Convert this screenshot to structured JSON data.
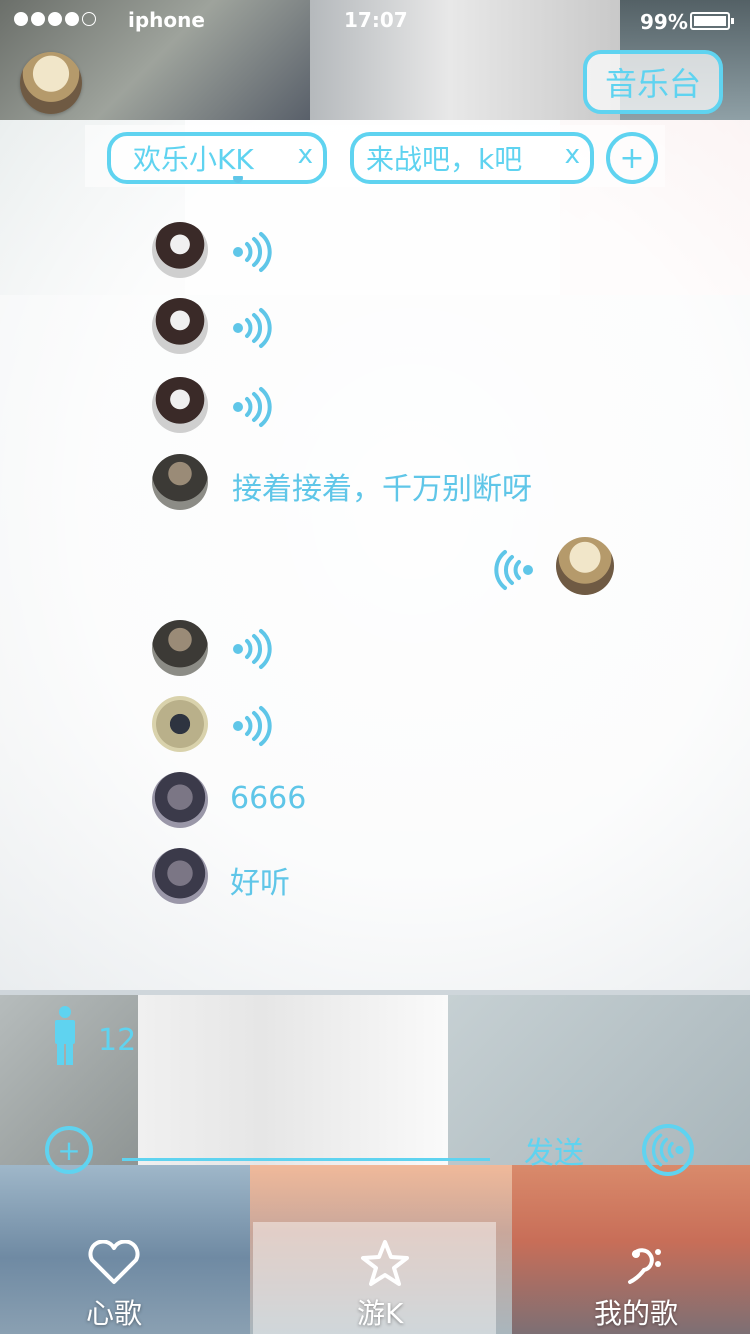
{
  "status_bar": {
    "carrier": "iphone",
    "time": "17:07",
    "battery": "99%"
  },
  "header": {
    "music_station_button": "音乐台"
  },
  "room_tabs": [
    {
      "label": "欢乐小KK",
      "close": "x"
    },
    {
      "label": "来战吧，k吧",
      "close": "x"
    }
  ],
  "add_tab_label": "+",
  "messages": [
    {
      "side": "left",
      "kind": "voice"
    },
    {
      "side": "left",
      "kind": "voice"
    },
    {
      "side": "left",
      "kind": "voice"
    },
    {
      "side": "left",
      "kind": "voice"
    },
    {
      "side": "left",
      "kind": "text",
      "text": "接着接着，千万别断呀"
    },
    {
      "side": "right",
      "kind": "voice"
    },
    {
      "side": "left",
      "kind": "voice"
    },
    {
      "side": "left",
      "kind": "voice"
    },
    {
      "side": "left",
      "kind": "text",
      "text": "6666"
    },
    {
      "side": "left",
      "kind": "text",
      "text": "好听"
    }
  ],
  "online_count": "12",
  "input_bar": {
    "plus_label": "+",
    "send_label": "发送",
    "value": ""
  },
  "tab_bar": [
    {
      "label": "心歌",
      "icon": "heart-icon"
    },
    {
      "label": "游K",
      "icon": "star-icon"
    },
    {
      "label": "我的歌",
      "icon": "bass-clef-icon"
    }
  ],
  "colors": {
    "accent": "#5fd3f0",
    "text": "#5fc6e8"
  }
}
